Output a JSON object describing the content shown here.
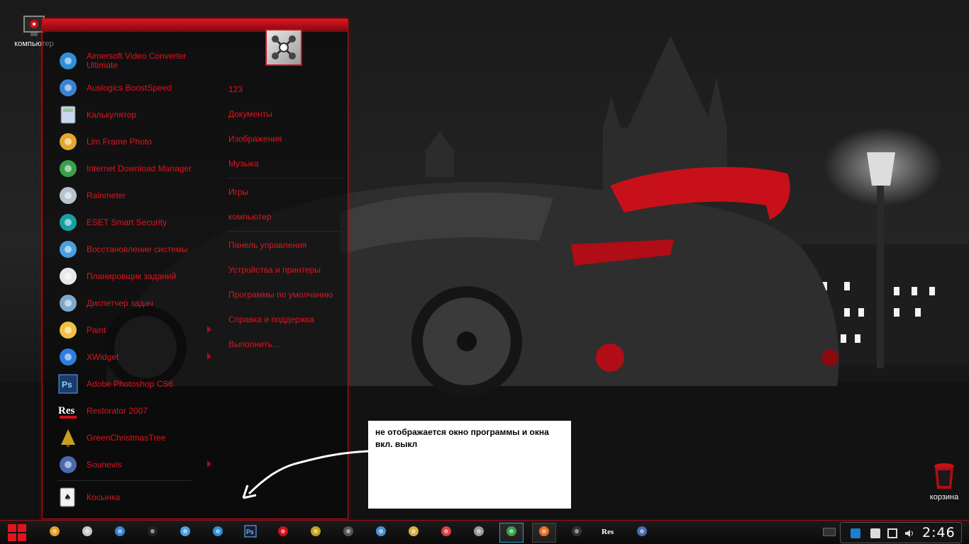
{
  "desktop": {
    "computer_label": "компьютер",
    "trash_label": "корзина"
  },
  "start_menu": {
    "programs": [
      {
        "label": "Aimersoft Video Converter Ultimate",
        "icon": "aimersoft-icon",
        "submenu": false
      },
      {
        "label": "Auslogics BoostSpeed",
        "icon": "boostspeed-icon",
        "submenu": false
      },
      {
        "label": "Калькулятор",
        "icon": "calculator-icon",
        "submenu": false
      },
      {
        "label": "Lim Frame Photo",
        "icon": "frame-photo-icon",
        "submenu": false
      },
      {
        "label": "Internet Download Manager",
        "icon": "idm-icon",
        "submenu": false
      },
      {
        "label": "Rainmeter",
        "icon": "rainmeter-icon",
        "submenu": false
      },
      {
        "label": "ESET Smart Security",
        "icon": "eset-icon",
        "submenu": false
      },
      {
        "label": "Восстановление системы",
        "icon": "system-restore-icon",
        "submenu": false
      },
      {
        "label": "Планировщик заданий",
        "icon": "task-scheduler-icon",
        "submenu": false
      },
      {
        "label": "Диспетчер задач",
        "icon": "task-manager-icon",
        "submenu": false
      },
      {
        "label": "Paint",
        "icon": "paint-icon",
        "submenu": true
      },
      {
        "label": "XWidget",
        "icon": "xwidget-icon",
        "submenu": true
      },
      {
        "label": "Adobe Photoshop CS6",
        "icon": "photoshop-icon",
        "submenu": false
      },
      {
        "label": "Restorator 2007",
        "icon": "restorator-icon",
        "submenu": false
      },
      {
        "label": "GreenChristmasTree",
        "icon": "christmas-tree-icon",
        "submenu": false
      },
      {
        "label": "Sounevis",
        "icon": "sounevis-icon",
        "submenu": true
      }
    ],
    "last_program": {
      "label": "Косынка",
      "icon": "solitaire-icon"
    },
    "places": [
      "123",
      "Документы",
      "Изображения",
      "Музыка",
      "Игры",
      "компьютер",
      "Панель управления",
      "Устройства и принтеры",
      "Программы по умолчанию",
      "Справка и поддержка",
      "Выполнить..."
    ]
  },
  "note": {
    "text": "не отображается окно программы и окна вкл. выкл"
  },
  "taskbar": {
    "pinned": [
      "aimp-icon",
      "boostspeed-icon",
      "browser-globe-icon",
      "media-player-icon",
      "settings-gear-icon",
      "aimersoft-icon",
      "photoshop-icon",
      "mcafee-icon",
      "christmas-tree-icon",
      "restorator-icon",
      "monitor-icon",
      "tools-icon",
      "red-gear-icon",
      "car-icon",
      "idm-icon",
      "firefox-icon",
      "tablet-icon",
      "res-icon",
      "sounevis-icon"
    ],
    "clock": "2:46"
  },
  "colors": {
    "accent": "#e0141e",
    "menu_border": "#b5121b"
  }
}
